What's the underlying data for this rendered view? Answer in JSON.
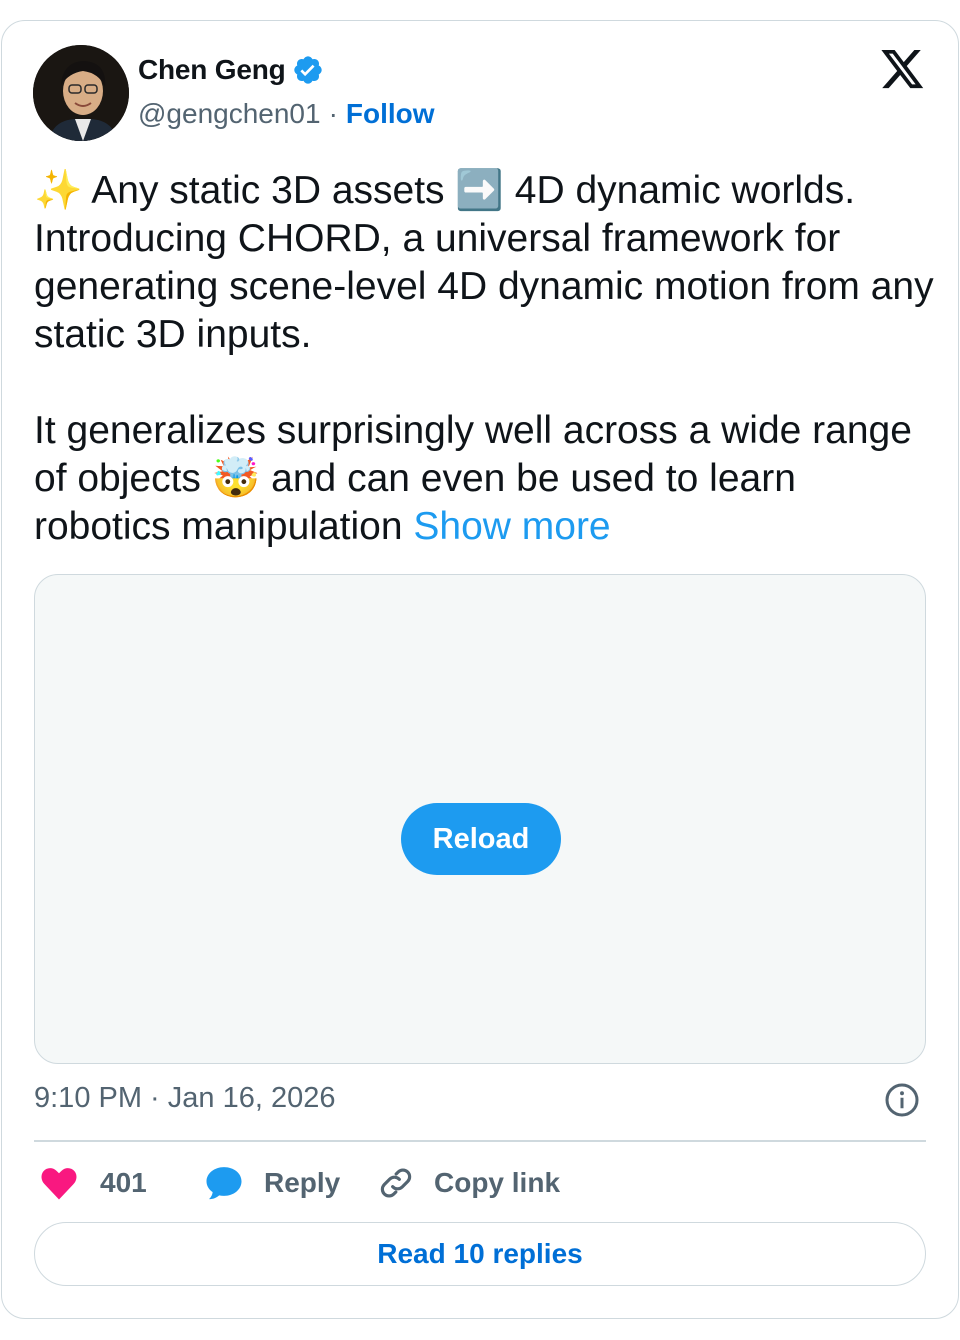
{
  "author": {
    "name": "Chen Geng",
    "handle": "@gengchen01",
    "separator": "·",
    "follow_label": "Follow"
  },
  "tweet": {
    "text": "✨ Any static 3D assets ➡️ 4D dynamic worlds.\nIntroducing CHORD, a universal framework for generating scene-level 4D dynamic motion from any static 3D inputs.\n\nIt generalizes surprisingly well across a wide range of objects 🤯 and can even be used to learn robotics manipulation ",
    "show_more_label": "Show more"
  },
  "media": {
    "reload_label": "Reload"
  },
  "meta": {
    "timestamp": "9:10 PM · Jan 16, 2026"
  },
  "actions": {
    "like_count": "401",
    "reply_label": "Reply",
    "copy_link_label": "Copy link"
  },
  "footer": {
    "read_replies_label": "Read 10 replies"
  },
  "colors": {
    "accent": "#1d9bf0",
    "link": "#006fd6",
    "like": "#f91880",
    "muted": "#536471",
    "border": "#cfd9de"
  },
  "icons": {
    "brand": "x-logo-icon",
    "verified": "verified-badge-icon",
    "like": "heart-icon",
    "reply": "speech-bubble-icon",
    "copy_link": "link-icon",
    "info": "info-icon"
  }
}
